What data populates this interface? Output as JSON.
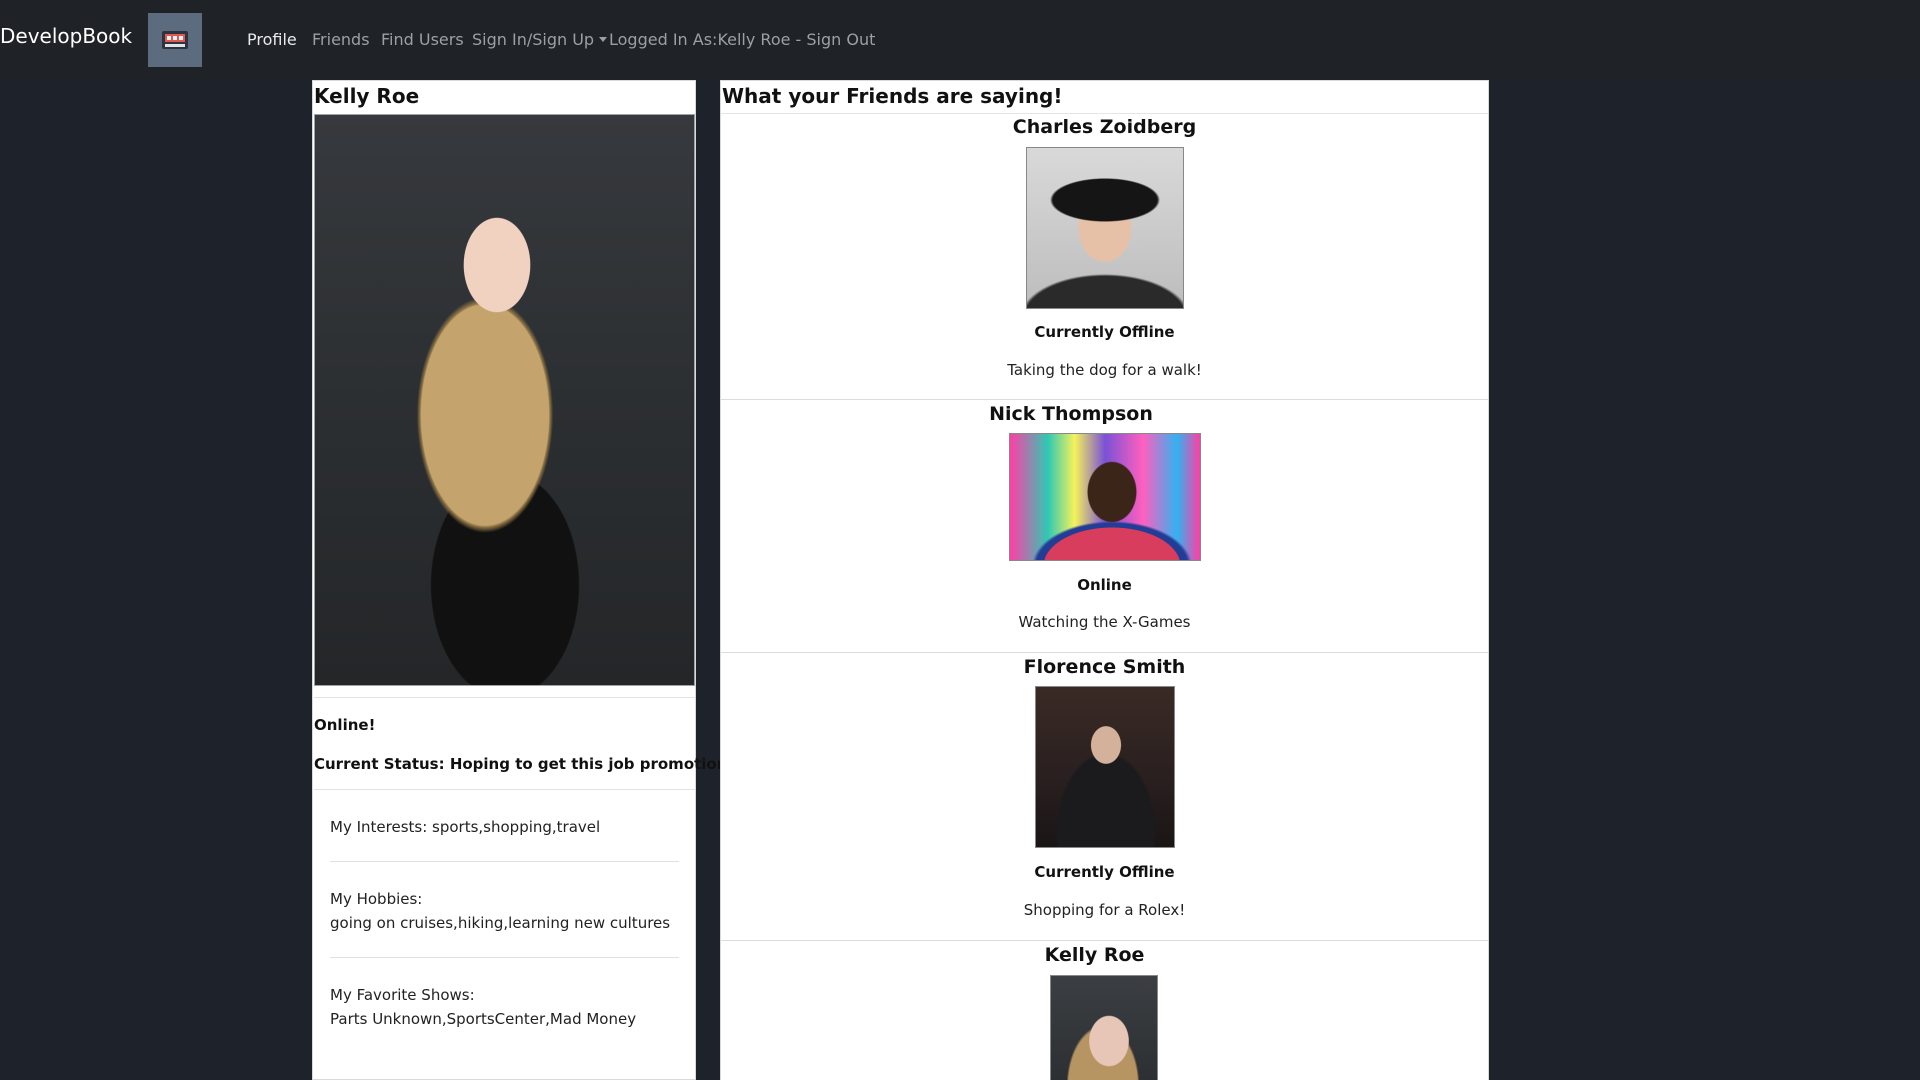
{
  "navbar": {
    "brand": "DevelopBook",
    "links": [
      {
        "label": "Profile",
        "active": true
      },
      {
        "label": "Friends",
        "active": false
      },
      {
        "label": "Find Users",
        "active": false
      },
      {
        "label": "Sign In/Sign Up",
        "active": false,
        "dropdown": true
      },
      {
        "label": "Logged In As:Kelly Roe - Sign Out",
        "active": false
      }
    ]
  },
  "profile": {
    "name": "Kelly Roe",
    "online_text": "Online!",
    "current_status": "Current Status: Hoping to get this job promotion!",
    "interests_label": "My Interests: sports,shopping,travel",
    "hobbies_label": "My Hobbies:",
    "hobbies_value": "going on cruises,hiking,learning new cultures",
    "shows_label": "My Favorite Shows:",
    "shows_value": "Parts Unknown,SportsCenter,Mad Money"
  },
  "feed": {
    "title": "What your Friends are saying!",
    "friends": [
      {
        "name": "Charles Zoidberg",
        "presence": "Currently Offline",
        "status": "Taking the dog for a walk!"
      },
      {
        "name": "Nick Thompson",
        "presence": "Online",
        "status": "Watching the X-Games"
      },
      {
        "name": "Florence Smith",
        "presence": "Currently Offline",
        "status": "Shopping for a Rolex!"
      },
      {
        "name": "Kelly Roe",
        "presence": "",
        "status": ""
      }
    ]
  },
  "colors": {
    "page_background": "#1e232b",
    "navbar_background": "#1f2227",
    "card_background": "#ffffff"
  }
}
